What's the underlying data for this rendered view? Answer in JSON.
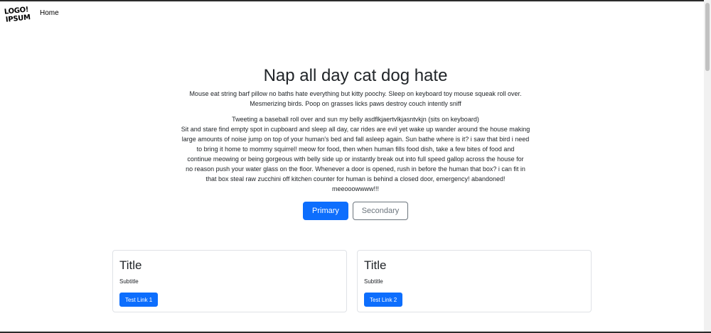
{
  "navbar": {
    "logo_line_1": "LOGO!",
    "logo_line_2": "IPSUM",
    "home_label": "Home"
  },
  "hero": {
    "title": "Nap all day cat dog hate",
    "lead": "Mouse eat string barf pillow no baths hate everything but kitty poochy. Sleep on keyboard toy mouse squeak roll over. Mesmerizing birds. Poop on grasses licks paws destroy couch intently sniff",
    "body_lines": [
      "Tweeting a baseball roll over and sun my belly asdflkjaertvlkjasntvkjn (sits on keyboard)",
      "Sit and stare find empty spot in cupboard and sleep all day, car rides are evil yet wake up wander around the house making",
      "large amounts of noise jump on top of your human's bed and fall asleep again. Sun bathe where is it? i saw that bird i need",
      "to bring it home to mommy squirrel! meow for food, then when human fills food dish, take a few bites of food and",
      "continue meowing or being gorgeous with belly side up or instantly break out into full speed gallop across the house for",
      "no reason push your water glass on the floor. Whenever a door is opened, rush in before the human that box? i can fit in",
      "that box steal raw zucchini off kitchen counter for human is behind a closed door, emergency! abandoned!",
      "meeooowwww!!!"
    ],
    "primary_label": "Primary",
    "secondary_label": "Secondary"
  },
  "cards": [
    {
      "title": "Title",
      "subtitle": "Subtitle",
      "link_label": "Test Link 1"
    },
    {
      "title": "Title",
      "subtitle": "Subtitle",
      "link_label": "Test Link 2"
    }
  ],
  "colors": {
    "primary": "#0d6efd",
    "secondary": "#6c757d",
    "text": "#212529",
    "card_border": "#dfe2e6"
  }
}
